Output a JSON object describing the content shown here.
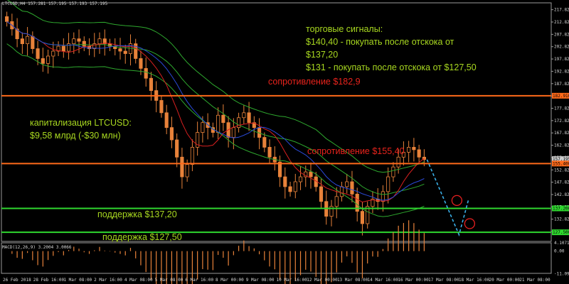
{
  "header": {
    "symbol_info": "LTCUSD,H4  157.281 157.195 157.193 157.195"
  },
  "macd_label": "MACD(12,26,9) 3.2004 3.0066",
  "annotations": {
    "signals_title": "торговые сигналы:",
    "signal_1": "$140,40 - покупать после отскока от",
    "signal_1b": "$137,20",
    "signal_2": "$131 - покупать после отскока от $127,50",
    "resistance_1": "сопротивление $182,9",
    "resistance_2": "сопротивление $155,40",
    "support_1": "поддержка $137,20",
    "support_2": "поддержка $127,50",
    "cap_title": "капитализация LTCUSD:",
    "cap_value": "$9,58 млрд (-$30 млн)"
  },
  "colors": {
    "background": "#000000",
    "bull_candle": "#e8823a",
    "bear_candle": "#e8823a",
    "resistance_line": "#ff6a1a",
    "support_line": "#2fd82f",
    "bollinger": "#2ea82e",
    "ma_red": "#d92020",
    "ma_blue": "#2a4ad8",
    "forecast": "#3ab0e8",
    "target_circle": "#e82020",
    "macd_hist": "#e8823a"
  },
  "chart_data": {
    "type": "candlestick",
    "ylim": [
      123.8,
      220.6
    ],
    "price_ticks": [
      "217.820",
      "212.820",
      "207.820",
      "202.820",
      "197.820",
      "192.820",
      "187.820",
      "182.820",
      "177.820",
      "172.820",
      "167.820",
      "162.820",
      "157.820",
      "152.820",
      "147.820",
      "142.820",
      "137.820",
      "132.820",
      "127.820",
      "123.028"
    ],
    "price_tick_values": [
      217.82,
      212.82,
      207.82,
      202.82,
      197.82,
      192.82,
      187.82,
      182.82,
      177.82,
      172.82,
      167.82,
      162.82,
      157.82,
      152.82,
      147.82,
      142.82,
      137.82,
      132.82,
      127.82,
      123.028
    ],
    "price_badges": [
      {
        "label": "182.910",
        "value": 182.91,
        "color": "#ff6a1a"
      },
      {
        "label": "157.195",
        "value": 157.195,
        "color": "#cccccc"
      },
      {
        "label": "155.400",
        "value": 155.4,
        "color": "#ff6a1a"
      },
      {
        "label": "137.200",
        "value": 137.2,
        "color": "#2fd82f"
      },
      {
        "label": "127.500",
        "value": 127.5,
        "color": "#2fd82f"
      }
    ],
    "time_labels": [
      "26 Feb 2018",
      "28 Feb 16:00",
      "1 Mar 08:00",
      "2 Mar 16:00",
      "4 Mar 08:00",
      "5 Mar 08:00",
      "6 Mar 16:00",
      "8 Mar 00:00",
      "9 Mar 08:00",
      "10 Mar 16:00",
      "12 Mar 00:00",
      "13 Mar 08:00",
      "14 Mar 16:00",
      "16 Mar 00:00",
      "17 Mar 08:00",
      "18 Mar 16:00",
      "20 Mar 00:00",
      "21 Mar 08:00"
    ],
    "levels": {
      "resistance": [
        182.9,
        155.4
      ],
      "support": [
        137.2,
        127.5
      ]
    },
    "close_path": [
      213,
      210,
      206,
      204,
      207,
      202,
      198,
      196,
      199,
      201,
      203,
      201,
      204,
      206,
      205,
      203,
      202,
      204,
      206,
      204,
      203,
      202,
      201,
      200,
      204,
      198,
      194,
      190,
      185,
      181,
      176,
      170,
      165,
      158,
      150,
      155,
      162,
      168,
      172,
      170,
      168,
      175,
      172,
      166,
      170,
      174,
      176,
      172,
      170,
      166,
      162,
      158,
      156,
      150,
      146,
      144,
      148,
      150,
      152,
      150,
      146,
      140,
      134,
      138,
      142,
      146,
      148,
      143,
      136,
      131,
      138,
      141,
      140,
      144,
      150,
      154,
      158,
      160,
      162,
      161,
      158,
      157
    ],
    "macd_ylim": [
      -11.0,
      4.1
    ],
    "macd_ticks": [
      "4.1071",
      "0.00",
      "-11.0955"
    ],
    "macd_tick_values": [
      4.1071,
      0,
      -11.0955
    ],
    "forecast": [
      {
        "label": "target $140.40",
        "value": 140.4
      },
      {
        "label": "target $131",
        "value": 131
      }
    ]
  }
}
